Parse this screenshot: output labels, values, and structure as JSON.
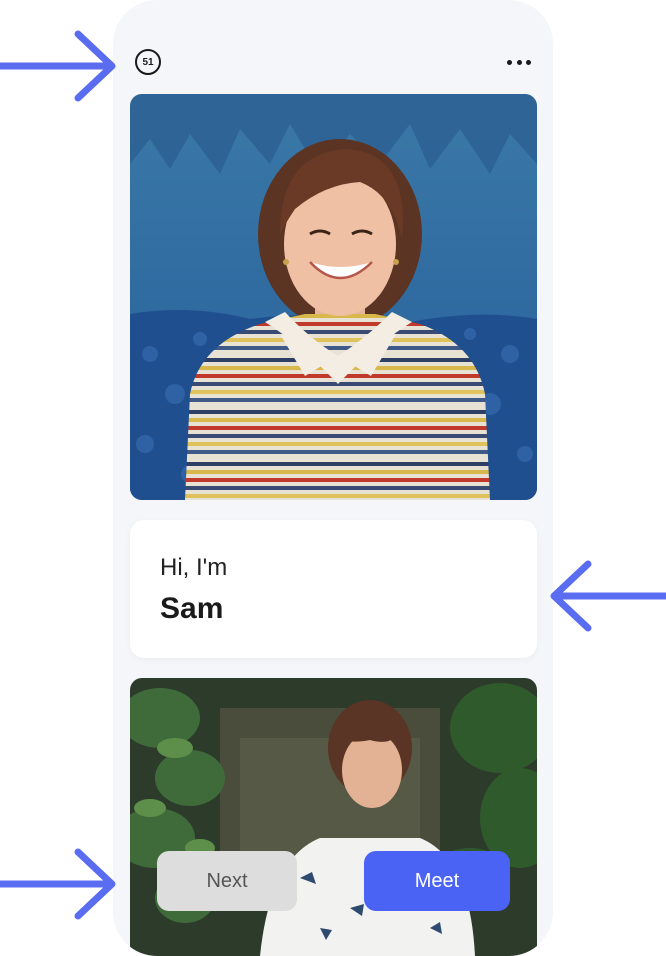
{
  "topbar": {
    "counter_value": "51",
    "counter_icon": "countdown-timer-icon",
    "more_icon": "more-dots-icon"
  },
  "intro": {
    "greeting": "Hi, I'm",
    "name": "Sam"
  },
  "actions": {
    "next_label": "Next",
    "meet_label": "Meet"
  },
  "colors": {
    "accent": "#4a63f5",
    "arrow": "#5a6cf0",
    "phone_bg": "#f5f6f9",
    "next_bg": "#dddddd"
  },
  "annotations": {
    "arrow_icon": "pointer-arrow-icon"
  }
}
